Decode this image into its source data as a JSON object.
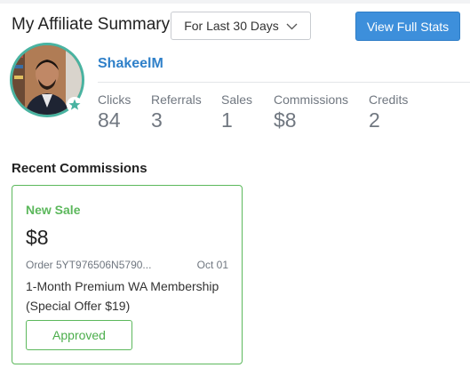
{
  "header": {
    "title": "My Affiliate Summary",
    "period_select": "For Last 30 Days",
    "full_stats_button": "View Full Stats"
  },
  "profile": {
    "username": "ShakeelM",
    "avatar_badge_icon": "star-icon"
  },
  "stats": [
    {
      "label": "Clicks",
      "value": "84"
    },
    {
      "label": "Referrals",
      "value": "3"
    },
    {
      "label": "Sales",
      "value": "1"
    },
    {
      "label": "Commissions",
      "value": "$8"
    },
    {
      "label": "Credits",
      "value": "2"
    }
  ],
  "recent_commissions": {
    "title": "Recent Commissions",
    "items": [
      {
        "tag": "New Sale",
        "amount": "$8",
        "order": "Order 5YT976506N5790...",
        "date": "Oct 01",
        "description": "1-Month Premium WA Membership (Special Offer $19)",
        "status": "Approved"
      }
    ]
  },
  "colors": {
    "accent_blue": "#3d8fdb",
    "link_blue": "#2f80c9",
    "success_green": "#5cb85c",
    "avatar_ring": "#49b3a1"
  }
}
